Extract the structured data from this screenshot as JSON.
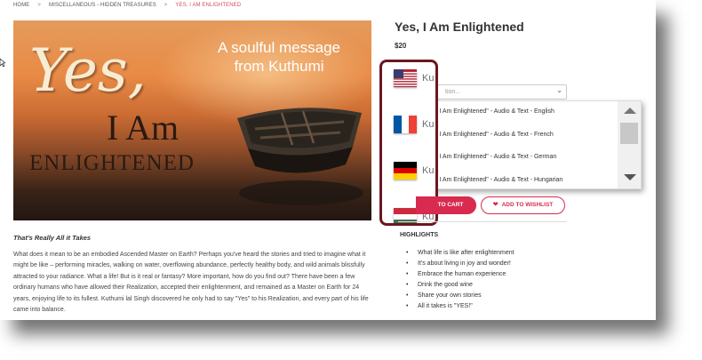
{
  "breadcrumb": {
    "home": "HOME",
    "category": "MISCELLANEOUS - HIDDEN TREASURES",
    "current": "YES, I AM ENLIGHTENED"
  },
  "hero": {
    "message": "A soulful message from Kuthumi",
    "title_yes": "Yes,",
    "title_iam": "I Am",
    "title_enlightened": "ENLIGHTENED"
  },
  "product": {
    "title": "Yes, I Am Enlightened",
    "price": "$20"
  },
  "select": {
    "placeholder": "tion...",
    "chevron_icon": "chevron-down-icon"
  },
  "dropdown": {
    "options": [
      "i \"Yes I Am Enlightened\" - Audio & Text - English",
      "i \"Yes I Am Enlightened\" - Audio & Text - French",
      "i \"Yes I Am Enlightened\" - Audio & Text - German",
      "i \"Yes I Am Enlightened\" - Audio & Text - Hungarian"
    ]
  },
  "languages": [
    {
      "flag": "usa-flag-icon",
      "text": "Ku"
    },
    {
      "flag": "france-flag-icon",
      "text": "Ku"
    },
    {
      "flag": "germany-flag-icon",
      "text": "Ku"
    },
    {
      "flag": "hungary-flag-icon",
      "text": "Ku"
    }
  ],
  "buttons": {
    "add_to_cart": "TO CART",
    "add_to_wishlist": "ADD TO WISHLIST",
    "heart_icon": "heart-icon"
  },
  "highlights": {
    "title": "HIGHLIGHTS",
    "items": [
      "What life is like after enlightenment",
      "It's about living in joy and wonder!",
      "Embrace the human experience",
      "Drink the good wine",
      "Share your own stories",
      "All it takes is \"YES!\""
    ]
  },
  "description": {
    "subtitle": "That's Really All it Takes",
    "body": "What does it mean to be an embodied Ascended Master on Earth? Perhaps you've heard the stories and tried to imagine what it might be like – performing miracles, walking on water, overflowing abundance, perfectly healthy body, and wild animals blissfully attracted to your radiance. What a life! But is it real or fantasy? More important, how do you find out? There have been a few ordinary humans who have allowed their Realization, accepted their enlightenment, and remained as a Master on Earth for 24 years, enjoying life to its fullest. Kuthumi lal Singh discovered he only had to say \"Yes\" to his Realization, and every part of his life came into balance."
  },
  "colors": {
    "accent": "#d92a4f",
    "highlight_box": "#6a1820",
    "breadcrumb_current": "#d64a66"
  }
}
